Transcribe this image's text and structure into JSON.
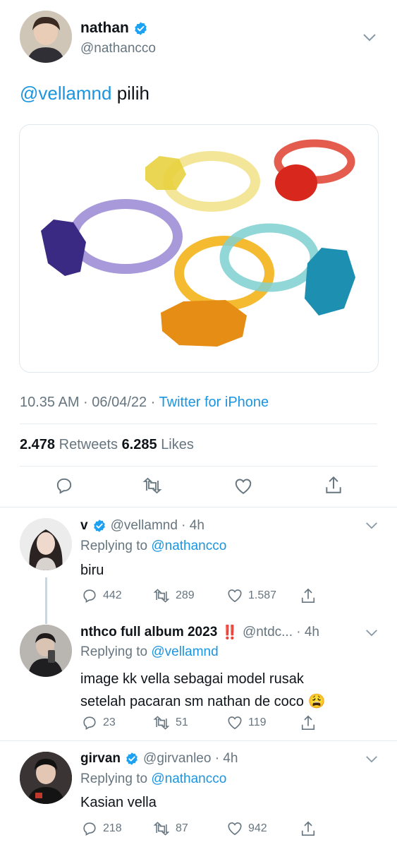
{
  "tweet": {
    "author_name": "nathan",
    "handle": "@nathancco",
    "text_mention": "@vellamnd",
    "text_body": "pilih",
    "timestamp": "10.35 AM · 06/04/22 ·",
    "source": "Twitter for iPhone",
    "retweets_count": "2.478",
    "retweets_label": "Retweets",
    "likes_count": "6.285",
    "likes_label": "Likes"
  },
  "replies": [
    {
      "author_name": "v",
      "handle_time": "@vellamnd · 4h",
      "replying_prefix": "Replying to",
      "replying_to": "@nathancco",
      "text": "biru",
      "reply_count": "442",
      "retweet_count": "289",
      "like_count": "1.587"
    },
    {
      "author_name": "nthco full album 2023",
      "author_marks": "‼️",
      "handle_time": "@ntdc... · 4h",
      "replying_prefix": "Replying to",
      "replying_to": "@vellamnd",
      "text_line1": "image kk vella sebagai model rusak",
      "text_line2": "setelah pacaran sm nathan de coco",
      "emoji": "😩",
      "reply_count": "23",
      "retweet_count": "51",
      "like_count": "119"
    },
    {
      "author_name": "girvan",
      "handle_time": "@girvanleo · 4h",
      "replying_prefix": "Replying to",
      "replying_to": "@nathancco",
      "text": "Kasian vella",
      "reply_count": "218",
      "retweet_count": "87",
      "like_count": "942"
    }
  ],
  "colors": {
    "link": "#1b95e0",
    "secondary": "#66757f",
    "divider": "#e6ecf0",
    "verified": "#1da1f2"
  }
}
